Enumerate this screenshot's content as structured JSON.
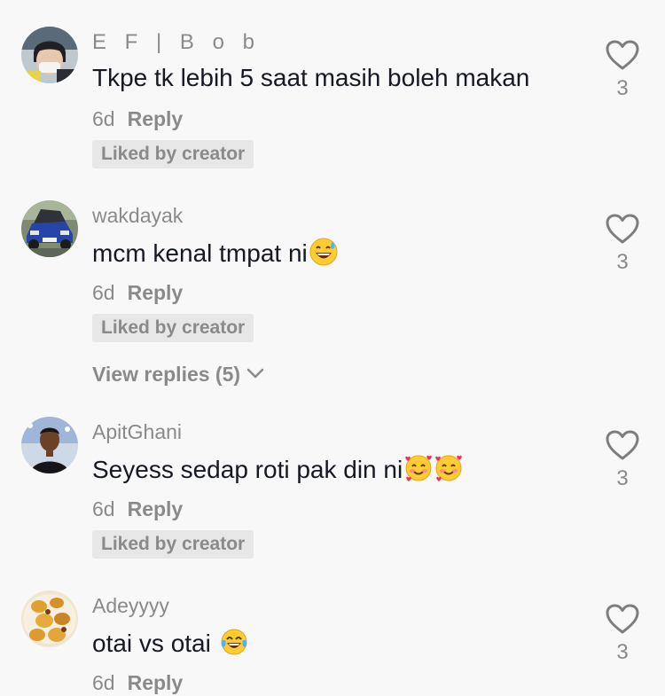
{
  "comments": [
    {
      "username": "E F | B o b",
      "text": "Tkpe tk lebih 5 saat masih boleh makan",
      "emoji": "",
      "time": "6d",
      "reply_label": "Reply",
      "liked_label": "Liked by creator",
      "likes": "3",
      "avatar": "boy-with-mask-avatar"
    },
    {
      "username": "wakdayak",
      "text": "mcm kenal tmpat ni",
      "emoji": "grinning-sweat-emoji",
      "time": "6d",
      "reply_label": "Reply",
      "liked_label": "Liked by creator",
      "likes": "3",
      "view_replies": "View replies (5)",
      "avatar": "blue-car-avatar"
    },
    {
      "username": "ApitGhani",
      "text": "Seyess sedap roti pak din ni",
      "emoji": "smiling-hearts-emoji x2",
      "time": "6d",
      "reply_label": "Reply",
      "liked_label": "Liked by creator",
      "likes": "3",
      "avatar": "man-portrait-avatar"
    },
    {
      "username": "Adeyyyy",
      "text": "otai vs otai ",
      "emoji": "tears-of-joy-emoji",
      "time": "6d",
      "reply_label": "Reply",
      "likes": "3",
      "avatar": "food-avatar"
    }
  ],
  "colors": {
    "background": "#f8f8f8",
    "primary_text": "#161823",
    "secondary_text": "#8a8a8a",
    "badge_background": "#e7e7e7"
  }
}
